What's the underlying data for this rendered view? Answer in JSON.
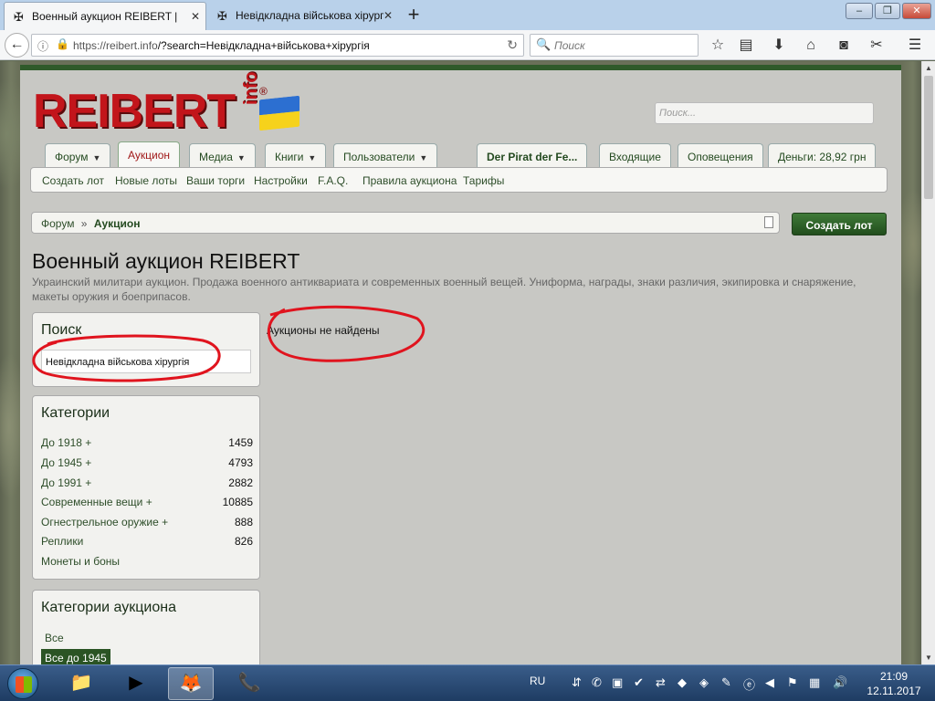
{
  "browser": {
    "tabs": [
      {
        "title": "Военный аукцион REIBERT |",
        "active": true
      },
      {
        "title": "Невідкладна військова хірург",
        "active": false
      }
    ],
    "url_host": "https://reibert.info",
    "url_path": "/?search=Невідкладна+військова+хірургія",
    "search_placeholder": "Поиск"
  },
  "site": {
    "logo_text": "REIBERT",
    "logo_suffix": "info",
    "logo_reg": "®",
    "search_placeholder": "Поиск..."
  },
  "main_nav": [
    {
      "label": "Форум",
      "dropdown": true
    },
    {
      "label": "Аукцион",
      "dropdown": false,
      "selected": true
    },
    {
      "label": "Медиа",
      "dropdown": true
    },
    {
      "label": "Книги",
      "dropdown": true
    },
    {
      "label": "Пользователи",
      "dropdown": true
    }
  ],
  "user_nav": [
    {
      "label": "Der Pirat der Fe..."
    },
    {
      "label": "Входящие"
    },
    {
      "label": "Оповещения"
    },
    {
      "label": "Деньги: 28,92 грн"
    }
  ],
  "sub_nav": [
    "Создать лот",
    "Новые лоты",
    "Ваши торги",
    "Настройки",
    "F.A.Q.",
    "Правила аукциона",
    "Тарифы"
  ],
  "breadcrumb": {
    "root": "Форум",
    "separator": "»",
    "current": "Аукцион"
  },
  "create_lot_button": "Создать лот",
  "page": {
    "title": "Военный аукцион REIBERT",
    "description": "Украинский милитари аукцион. Продажа военного антиквариата и современных военный вещей. Униформа, награды, знаки различия, экипировка и снаряжение, макеты оружия и боеприпасов.",
    "no_results": "Аукционы не найдены"
  },
  "search_panel": {
    "title": "Поиск",
    "value": "Невідкладна військова хірургія"
  },
  "categories": {
    "title": "Категории",
    "items": [
      {
        "label": "До 1918 +",
        "count": "1459"
      },
      {
        "label": "До 1945 +",
        "count": "4793"
      },
      {
        "label": "До 1991 +",
        "count": "2882"
      },
      {
        "label": "Современные вещи +",
        "count": "10885"
      },
      {
        "label": "Огнестрельное оружие +",
        "count": "888"
      },
      {
        "label": "Реплики",
        "count": "826"
      },
      {
        "label": "Монеты и боны",
        "count": ""
      }
    ]
  },
  "auction_categories": {
    "title": "Категории аукциона",
    "items": [
      {
        "label": "Все",
        "selected": false
      },
      {
        "label": "Все до 1945",
        "selected": true
      }
    ]
  },
  "taskbar": {
    "language": "RU",
    "time": "21:09",
    "date": "12.11.2017"
  },
  "colors": {
    "accent_green": "#2b5424",
    "logo_red": "#c2151b",
    "annotation_red": "#e0141e"
  }
}
